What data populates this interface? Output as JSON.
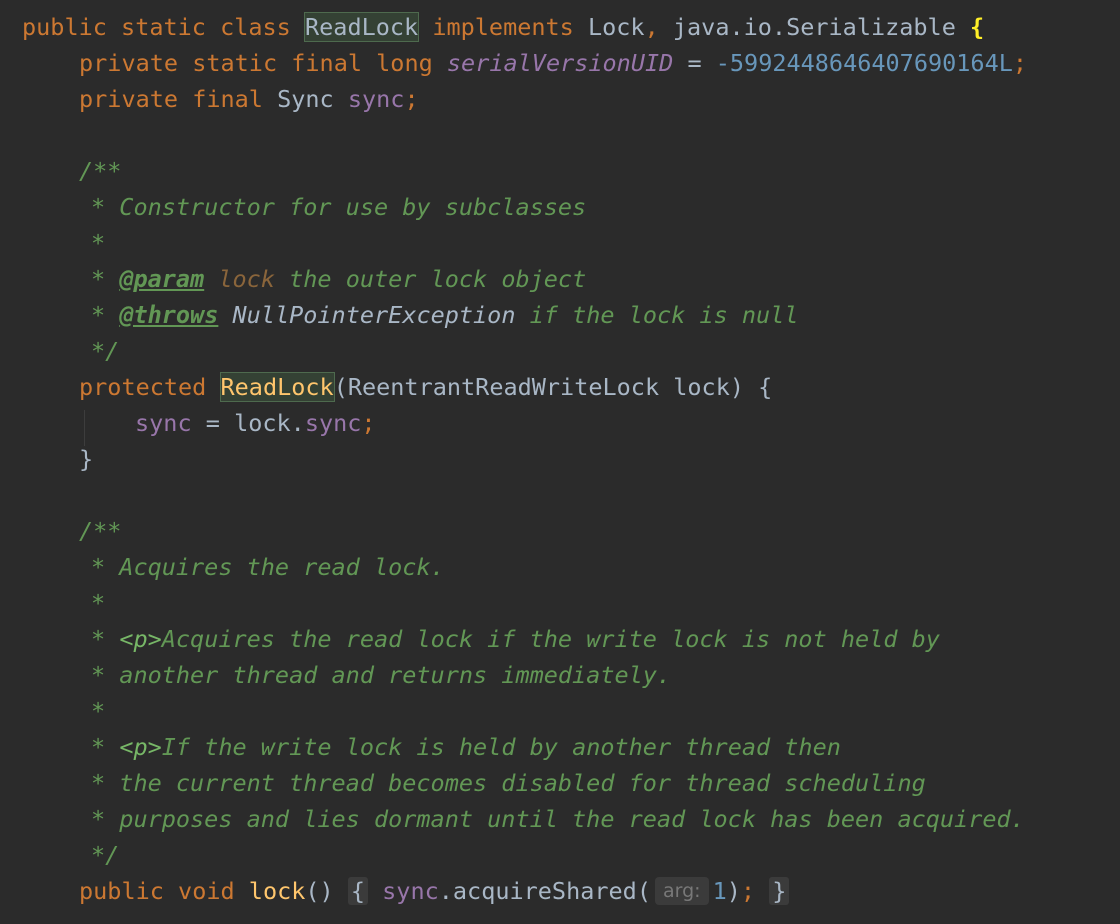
{
  "line1": {
    "kw_public": "public",
    "kw_static": "static",
    "kw_class": "class",
    "class_name": "ReadLock",
    "kw_implements": "implements",
    "iface_lock": "Lock",
    "comma": ",",
    "iface_serializable": "java.io.Serializable",
    "brace": "{"
  },
  "line2": {
    "kw_private": "private",
    "kw_static": "static",
    "kw_final": "final",
    "kw_long": "long",
    "field": "serialVersionUID",
    "eq": "=",
    "value": "-5992448646407690164L",
    "semi": ";"
  },
  "line3": {
    "kw_private": "private",
    "kw_final": "final",
    "type": "Sync",
    "field": "sync",
    "semi": ";"
  },
  "doc1": {
    "open": "/**",
    "desc": "* Constructor for use by subclasses",
    "blank": "*",
    "star": "*",
    "param_tag": "@param",
    "param_name": "lock",
    "param_desc": "the outer lock object",
    "throws_tag": "@throws",
    "throws_type": "NullPointerException",
    "throws_desc": "if the lock is null",
    "close": "*/"
  },
  "ctor": {
    "kw_protected": "protected",
    "name": "ReadLock",
    "params": "(ReentrantReadWriteLock lock) {",
    "body_field": "sync",
    "body_eq": "=",
    "body_obj": "lock.",
    "body_member": "sync",
    "body_semi": ";",
    "close": "}"
  },
  "doc2": {
    "open": "/**",
    "l1": "* Acquires the read lock.",
    "blank": "*",
    "star": "*",
    "p_tag": "<p>",
    "l3": "Acquires the read lock if the write lock is not held by",
    "l4": "* another thread and returns immediately.",
    "l6": "If the write lock is held by another thread then",
    "l7": "* the current thread becomes disabled for thread scheduling",
    "l8": "* purposes and lies dormant until the read lock has been acquired.",
    "close": "*/"
  },
  "lock_method": {
    "kw_public": "public",
    "kw_void": "void",
    "name": "lock",
    "parens": "()",
    "fold_open": "{",
    "field": "sync",
    "call": ".acquireShared(",
    "hint": "arg:",
    "arg": "1",
    "close_paren": ")",
    "semi": ";",
    "fold_close": "}"
  }
}
